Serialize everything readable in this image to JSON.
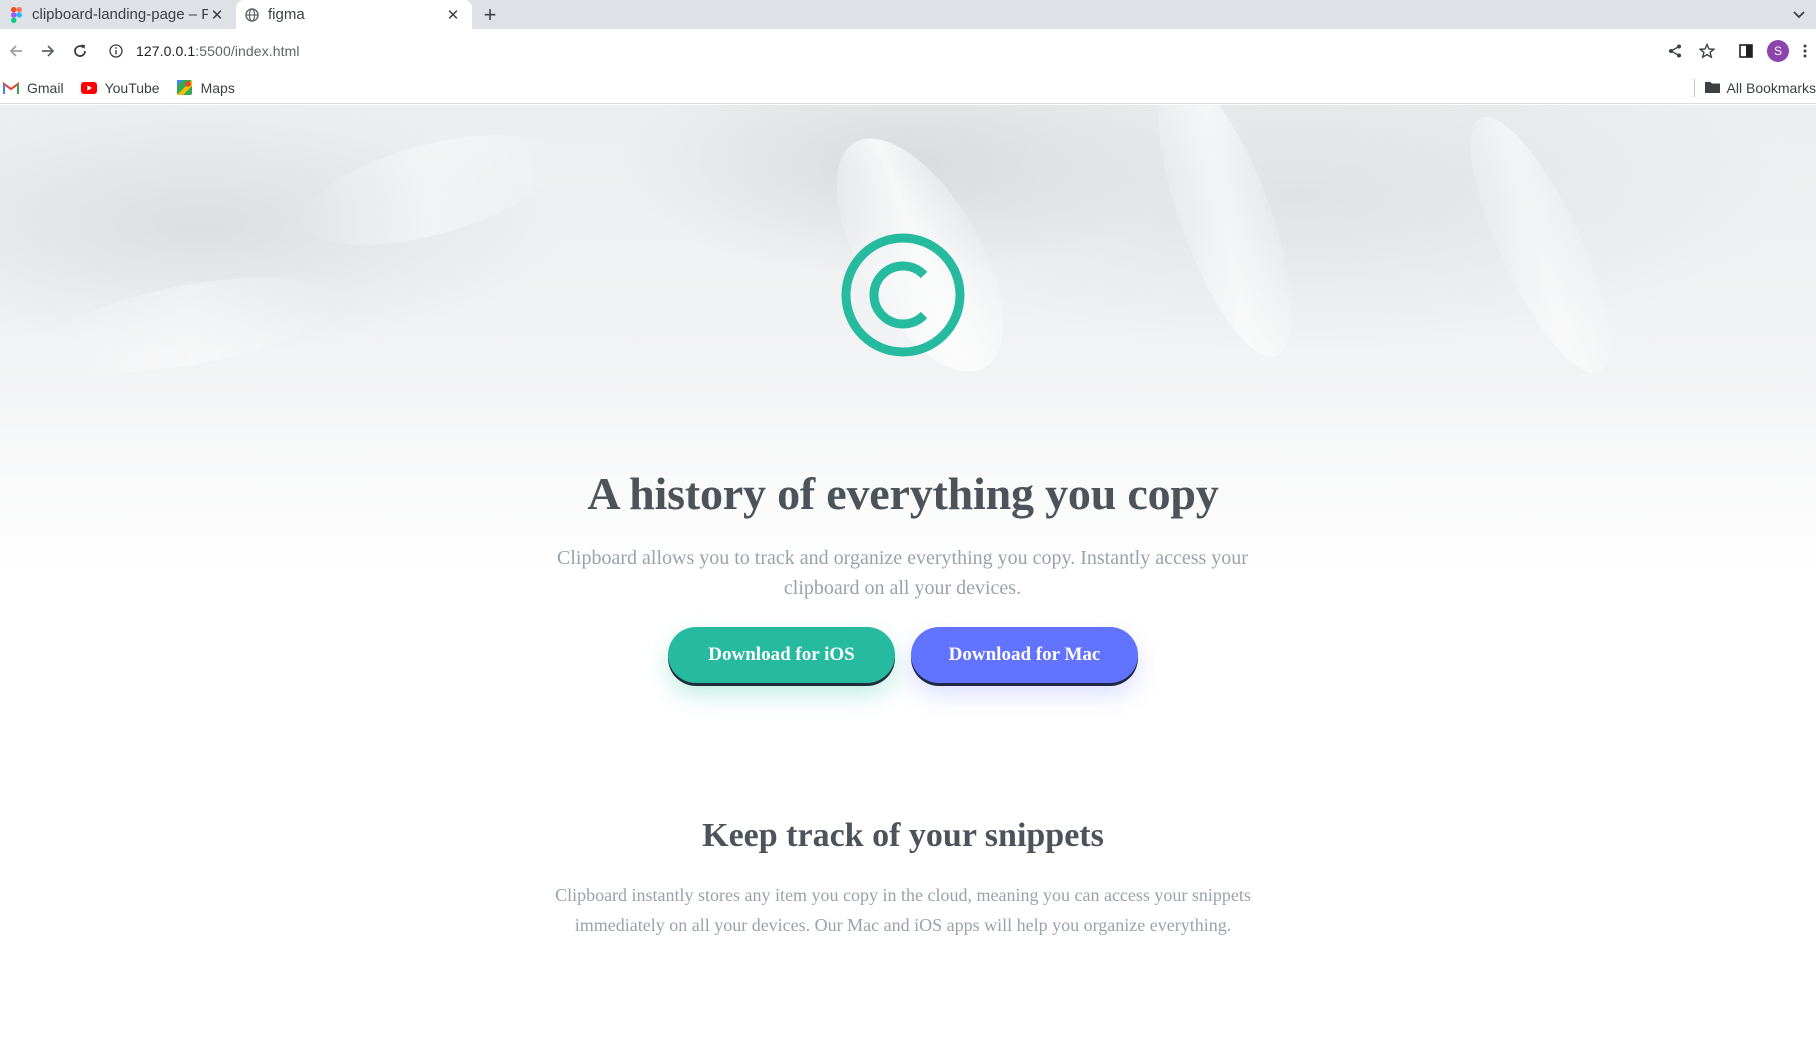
{
  "browser": {
    "tabs": [
      {
        "title": "clipboard-landing-page – Figma",
        "active": false,
        "icon": "figma-icon"
      },
      {
        "title": "figma",
        "active": true,
        "icon": "globe-icon"
      }
    ],
    "url": {
      "host": "127.0.0.1",
      "path": ":5500/index.html"
    },
    "profile_initial": "S",
    "bookmarks": [
      {
        "label": "Gmail",
        "icon": "gmail-icon"
      },
      {
        "label": "YouTube",
        "icon": "youtube-icon"
      },
      {
        "label": "Maps",
        "icon": "maps-icon"
      }
    ],
    "all_bookmarks_label": "All Bookmarks"
  },
  "hero": {
    "title": "A history of everything you copy",
    "text": "Clipboard allows you to track and organize everything you copy. Instantly access your clipboard on all your devices.",
    "ios_button": "Download for iOS",
    "mac_button": "Download for Mac"
  },
  "snippets": {
    "title": "Keep track of your snippets",
    "text": "Clipboard instantly stores any item you copy in the cloud, meaning you can access your snippets immediately on all your devices. Our Mac and iOS apps will help you organize everything."
  },
  "colors": {
    "ios_button": "#26ba9f",
    "mac_button": "#6173ff",
    "heading": "#4c535b",
    "body_text": "#9aa2ab",
    "logo": "#26ba9f"
  }
}
